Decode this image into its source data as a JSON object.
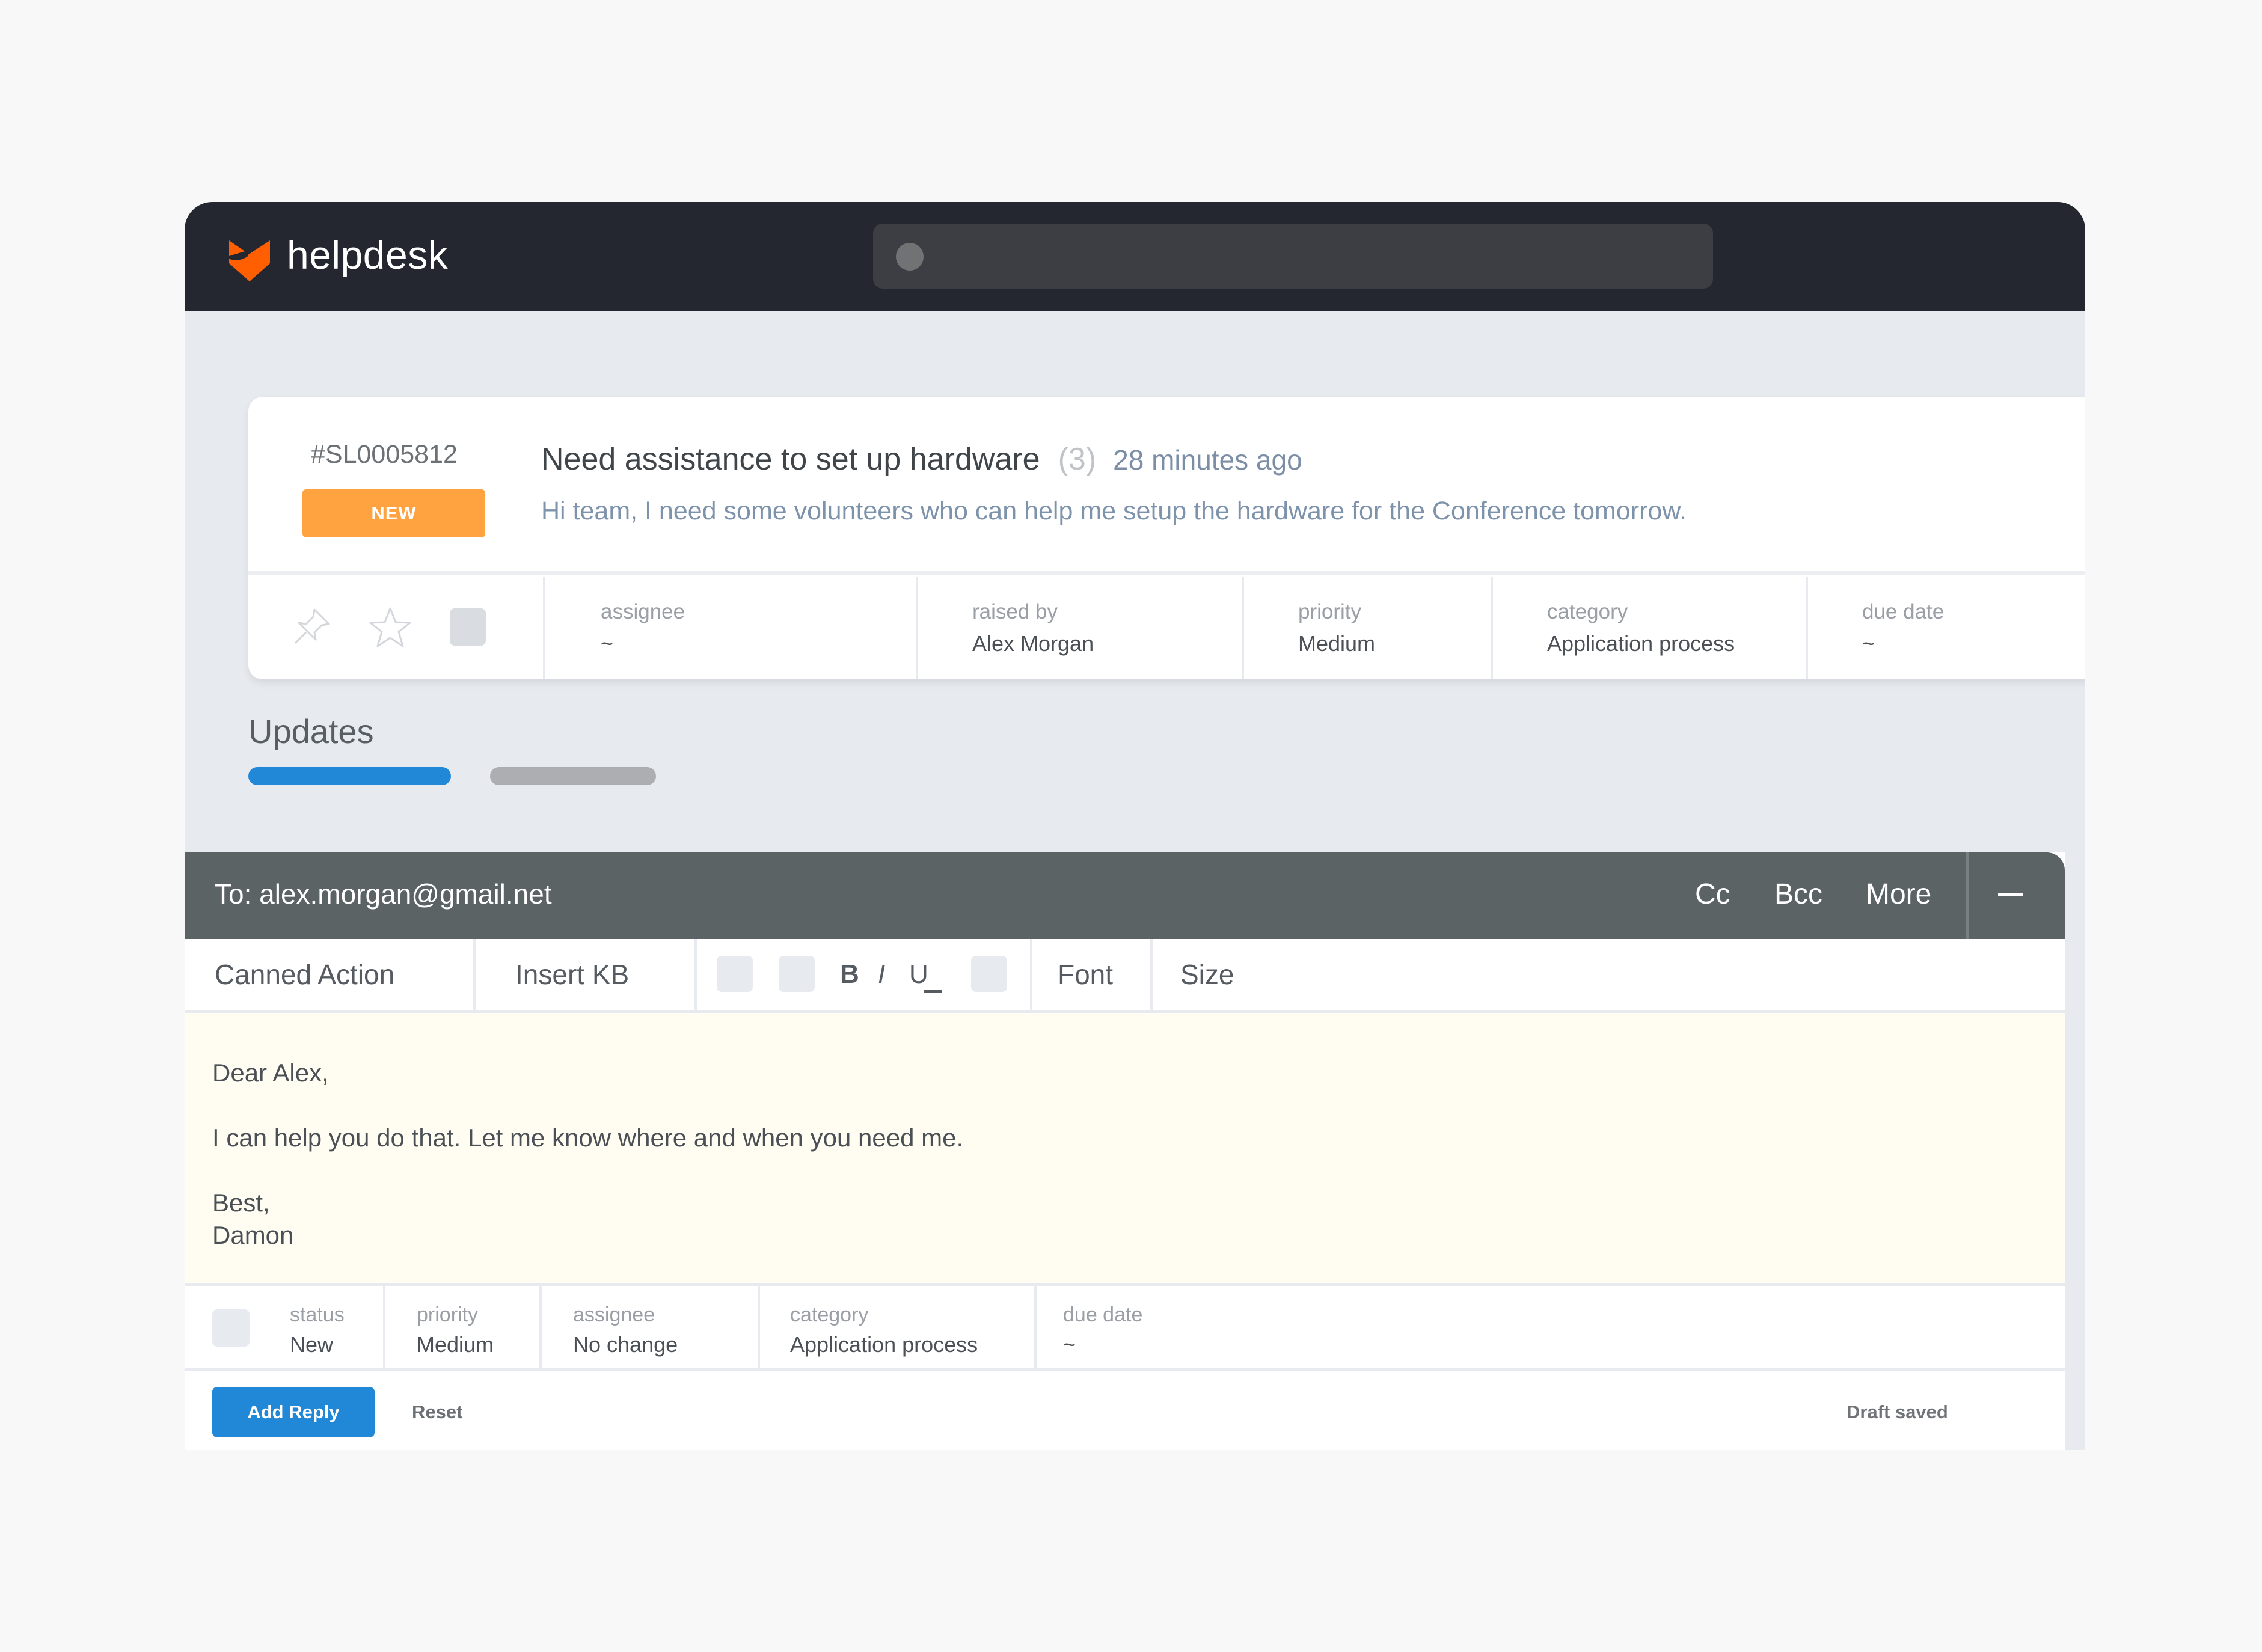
{
  "app": {
    "name": "helpdesk",
    "brand_color": "#ff5f00",
    "accent_color": "#2188d8",
    "logo_icon": "fox-shield-icon",
    "search_icon": "search-dot-icon"
  },
  "ticket": {
    "id": "#SL0005812",
    "status_badge": "NEW",
    "status_color": "#ffa341",
    "title": "Need assistance to set up hardware",
    "reply_count": "(3)",
    "time_ago": "28 minutes ago",
    "description": "Hi team, I need some volunteers who can help me setup the hardware for the Conference tomorrow.",
    "actions": [
      {
        "icon": "pin-icon"
      },
      {
        "icon": "star-icon"
      },
      {
        "icon": "checkbox-icon"
      }
    ],
    "meta": [
      {
        "label": "assignee",
        "value": "~"
      },
      {
        "label": "raised by",
        "value": "Alex Morgan"
      },
      {
        "label": "priority",
        "value": "Medium"
      },
      {
        "label": "category",
        "value": "Application process"
      },
      {
        "label": "due date",
        "value": "~"
      }
    ]
  },
  "updates": {
    "title": "Updates",
    "tabs": [
      {
        "state": "active"
      },
      {
        "state": "inactive"
      }
    ]
  },
  "compose": {
    "to": "To: alex.morgan@gmail.net",
    "header_links": [
      "Cc",
      "Bcc",
      "More"
    ],
    "minimize_icon": "minimize-icon",
    "toolbar": {
      "canned_action": "Canned Action",
      "insert_kb": "Insert KB",
      "bold": "B",
      "italic": "I",
      "underline": "U",
      "font": "Font",
      "size": "Size"
    },
    "body": {
      "greeting": "Dear Alex,",
      "message": "I can help you do that. Let me know where and when you need me.",
      "signoff": "Best,",
      "signature": "Damon"
    },
    "fields": [
      {
        "label": "status",
        "value": "New"
      },
      {
        "label": "priority",
        "value": "Medium"
      },
      {
        "label": "assignee",
        "value": "No change"
      },
      {
        "label": "category",
        "value": "Application process"
      },
      {
        "label": "due date",
        "value": "~"
      }
    ],
    "add_reply": "Add Reply",
    "reset": "Reset",
    "draft_status": "Draft saved"
  }
}
